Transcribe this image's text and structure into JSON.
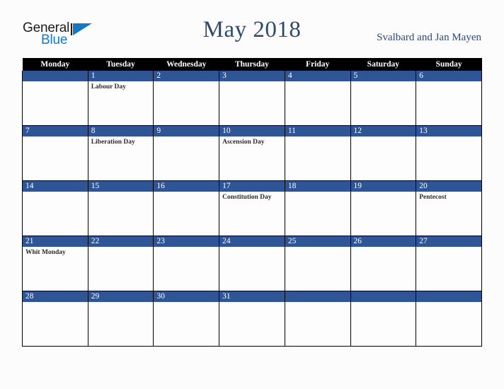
{
  "brand": {
    "name_part1": "General",
    "name_part2": "Blue",
    "triangle_color": "#1878be"
  },
  "header": {
    "title": "May 2018",
    "country": "Svalbard and Jan Mayen",
    "title_color": "#2e4a72"
  },
  "calendar": {
    "weekday_headers": [
      "Monday",
      "Tuesday",
      "Wednesday",
      "Thursday",
      "Friday",
      "Saturday",
      "Sunday"
    ],
    "day_band_color": "#2f5597",
    "header_bg_color": "#000000",
    "weeks": [
      [
        {
          "day": "",
          "events": []
        },
        {
          "day": "1",
          "events": [
            "Labour Day"
          ]
        },
        {
          "day": "2",
          "events": []
        },
        {
          "day": "3",
          "events": []
        },
        {
          "day": "4",
          "events": []
        },
        {
          "day": "5",
          "events": []
        },
        {
          "day": "6",
          "events": []
        }
      ],
      [
        {
          "day": "7",
          "events": []
        },
        {
          "day": "8",
          "events": [
            "Liberation Day"
          ]
        },
        {
          "day": "9",
          "events": []
        },
        {
          "day": "10",
          "events": [
            "Ascension Day"
          ]
        },
        {
          "day": "11",
          "events": []
        },
        {
          "day": "12",
          "events": []
        },
        {
          "day": "13",
          "events": []
        }
      ],
      [
        {
          "day": "14",
          "events": []
        },
        {
          "day": "15",
          "events": []
        },
        {
          "day": "16",
          "events": []
        },
        {
          "day": "17",
          "events": [
            "Constitution Day"
          ]
        },
        {
          "day": "18",
          "events": []
        },
        {
          "day": "19",
          "events": []
        },
        {
          "day": "20",
          "events": [
            "Pentecost"
          ]
        }
      ],
      [
        {
          "day": "21",
          "events": [
            "Whit Monday"
          ]
        },
        {
          "day": "22",
          "events": []
        },
        {
          "day": "23",
          "events": []
        },
        {
          "day": "24",
          "events": []
        },
        {
          "day": "25",
          "events": []
        },
        {
          "day": "26",
          "events": []
        },
        {
          "day": "27",
          "events": []
        }
      ],
      [
        {
          "day": "28",
          "events": []
        },
        {
          "day": "29",
          "events": []
        },
        {
          "day": "30",
          "events": []
        },
        {
          "day": "31",
          "events": []
        },
        {
          "day": "",
          "events": []
        },
        {
          "day": "",
          "events": []
        },
        {
          "day": "",
          "events": []
        }
      ]
    ]
  }
}
